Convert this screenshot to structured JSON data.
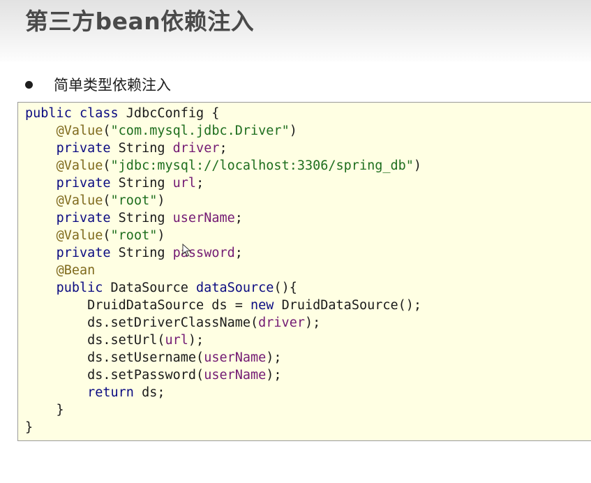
{
  "slide": {
    "title": "第三方bean依赖注入",
    "bullet": "简单类型依赖注入"
  },
  "code": {
    "lines": [
      [
        {
          "t": "public class",
          "c": "kw"
        },
        {
          "t": " JdbcConfig {",
          "c": ""
        }
      ],
      [
        {
          "t": "    ",
          "c": ""
        },
        {
          "t": "@Value",
          "c": "ann"
        },
        {
          "t": "(",
          "c": ""
        },
        {
          "t": "\"com.mysql.jdbc.Driver\"",
          "c": "str"
        },
        {
          "t": ")",
          "c": ""
        }
      ],
      [
        {
          "t": "    ",
          "c": ""
        },
        {
          "t": "private",
          "c": "kw"
        },
        {
          "t": " String ",
          "c": ""
        },
        {
          "t": "driver",
          "c": "field"
        },
        {
          "t": ";",
          "c": ""
        }
      ],
      [
        {
          "t": "    ",
          "c": ""
        },
        {
          "t": "@Value",
          "c": "ann"
        },
        {
          "t": "(",
          "c": ""
        },
        {
          "t": "\"jdbc:mysql://localhost:3306/spring_db\"",
          "c": "str"
        },
        {
          "t": ")",
          "c": ""
        }
      ],
      [
        {
          "t": "    ",
          "c": ""
        },
        {
          "t": "private",
          "c": "kw"
        },
        {
          "t": " String ",
          "c": ""
        },
        {
          "t": "url",
          "c": "field"
        },
        {
          "t": ";",
          "c": ""
        }
      ],
      [
        {
          "t": "    ",
          "c": ""
        },
        {
          "t": "@Value",
          "c": "ann"
        },
        {
          "t": "(",
          "c": ""
        },
        {
          "t": "\"root\"",
          "c": "str"
        },
        {
          "t": ")",
          "c": ""
        }
      ],
      [
        {
          "t": "    ",
          "c": ""
        },
        {
          "t": "private",
          "c": "kw"
        },
        {
          "t": " String ",
          "c": ""
        },
        {
          "t": "userName",
          "c": "field"
        },
        {
          "t": ";",
          "c": ""
        }
      ],
      [
        {
          "t": "    ",
          "c": ""
        },
        {
          "t": "@Value",
          "c": "ann"
        },
        {
          "t": "(",
          "c": ""
        },
        {
          "t": "\"root\"",
          "c": "str"
        },
        {
          "t": ")",
          "c": ""
        }
      ],
      [
        {
          "t": "    ",
          "c": ""
        },
        {
          "t": "private",
          "c": "kw"
        },
        {
          "t": " String ",
          "c": ""
        },
        {
          "t": "password",
          "c": "field"
        },
        {
          "t": ";",
          "c": ""
        }
      ],
      [
        {
          "t": "    ",
          "c": ""
        },
        {
          "t": "@Bean",
          "c": "ann"
        }
      ],
      [
        {
          "t": "    ",
          "c": ""
        },
        {
          "t": "public",
          "c": "kw"
        },
        {
          "t": " DataSource ",
          "c": ""
        },
        {
          "t": "dataSource",
          "c": "kw"
        },
        {
          "t": "(){",
          "c": ""
        }
      ],
      [
        {
          "t": "        DruidDataSource ds = ",
          "c": ""
        },
        {
          "t": "new",
          "c": "kw"
        },
        {
          "t": " DruidDataSource();",
          "c": ""
        }
      ],
      [
        {
          "t": "        ds.setDriverClassName(",
          "c": ""
        },
        {
          "t": "driver",
          "c": "field"
        },
        {
          "t": ");",
          "c": ""
        }
      ],
      [
        {
          "t": "        ds.setUrl(",
          "c": ""
        },
        {
          "t": "url",
          "c": "field"
        },
        {
          "t": ");",
          "c": ""
        }
      ],
      [
        {
          "t": "        ds.setUsername(",
          "c": ""
        },
        {
          "t": "userName",
          "c": "field"
        },
        {
          "t": ");",
          "c": ""
        }
      ],
      [
        {
          "t": "        ds.setPassword(",
          "c": ""
        },
        {
          "t": "userName",
          "c": "field"
        },
        {
          "t": ");",
          "c": ""
        }
      ],
      [
        {
          "t": "        ",
          "c": ""
        },
        {
          "t": "return",
          "c": "kw"
        },
        {
          "t": " ds;",
          "c": ""
        }
      ],
      [
        {
          "t": "    }",
          "c": ""
        }
      ],
      [
        {
          "t": "}",
          "c": ""
        }
      ]
    ]
  },
  "colors": {
    "code_background": "#ffffe3",
    "keyword": "#0b0b82",
    "annotation": "#7f6a1d",
    "string": "#1e6e1e",
    "field": "#731a73"
  },
  "icons": {
    "cursor": "mouse-pointer-icon"
  }
}
